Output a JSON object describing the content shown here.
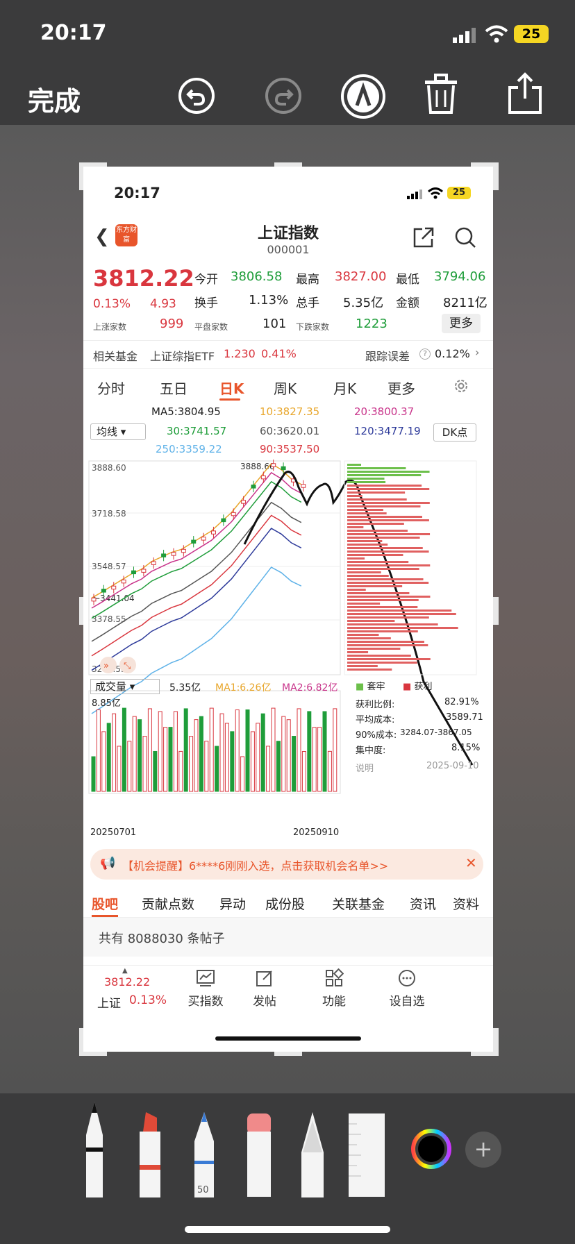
{
  "status_bar": {
    "time": "20:17",
    "battery": "25"
  },
  "markup_toolbar": {
    "done": "完成",
    "tools": [
      "undo-icon",
      "redo-icon",
      "markup-pen-icon",
      "trash-icon",
      "share-icon"
    ]
  },
  "inner_status": {
    "time": "20:17",
    "battery": "25"
  },
  "header": {
    "title": "上证指数",
    "code": "000001",
    "logo": "东方财富"
  },
  "quote": {
    "price": "3812.22",
    "change_pct": "0.13%",
    "change": "4.93",
    "open_label": "今开",
    "open": "3806.58",
    "high_label": "最高",
    "high": "3827.00",
    "low_label": "最低",
    "low": "3794.06",
    "turnover_label": "换手",
    "turnover": "1.13%",
    "volume_label": "总手",
    "volume": "5.35亿",
    "amount_label": "金额",
    "amount": "8211亿",
    "up_label": "上涨家数",
    "up": "999",
    "flat_label": "平盘家数",
    "flat": "101",
    "down_label": "下跌家数",
    "down": "1223",
    "more": "更多"
  },
  "fund": {
    "label": "相关基金",
    "name": "上证综指ETF",
    "price": "1.230",
    "pct": "0.41%",
    "err_label": "跟踪误差",
    "err": "0.12%"
  },
  "period_tabs": [
    "分时",
    "五日",
    "日K",
    "周K",
    "月K",
    "更多"
  ],
  "ma": {
    "selector": "均线",
    "ma5": "MA5:3804.95",
    "ma10": "10:3827.35",
    "ma20": "20:3800.37",
    "ma30": "30:3741.57",
    "ma60": "60:3620.01",
    "ma120": "120:3477.19",
    "ma250": "250:3359.22",
    "ma90": "90:3537.50",
    "dk": "DK点"
  },
  "chart_data": {
    "type": "line",
    "title": "",
    "y_ticks": [
      "3888.60",
      "3718.58",
      "3548.57",
      "3378.55",
      "3208.53"
    ],
    "high_marker": "3888.60",
    "low_marker": "3441.04",
    "ylim": [
      3208.53,
      3888.6
    ],
    "series": [
      {
        "name": "",
        "values": [
          3441,
          3460,
          3480,
          3500,
          3520,
          3535,
          3560,
          3575,
          3590,
          3600,
          3620,
          3640,
          3660,
          3690,
          3720,
          3760,
          3800,
          3840,
          3880,
          3860,
          3830,
          3812
        ]
      }
    ],
    "volume_label": "成交量",
    "volume_value": "5.35亿",
    "vol_ma1": "MA1:6.26亿",
    "vol_ma2": "MA2:6.82亿",
    "vol_top": "8.85亿",
    "x_start": "20250701",
    "x_end": "20250910"
  },
  "chips": {
    "legend_a": "套牢",
    "legend_b": "获利",
    "profit_label": "获利比例:",
    "profit": "82.91%",
    "cost_label": "平均成本:",
    "cost": "3589.71",
    "range_label": "90%成本:",
    "range": "3284.07-3867.05",
    "conc_label": "集中度:",
    "conc": "8.15%",
    "note": "说明",
    "date": "2025-09-10"
  },
  "banner": {
    "text": "【机会提醒】6****6刚刚入选，点击获取机会名单>>"
  },
  "sub_tabs": [
    "股吧",
    "贡献点数",
    "异动",
    "成份股",
    "关联基金",
    "资讯",
    "资料"
  ],
  "posts": "共有 8088030 条帖子",
  "bottom_nav": {
    "price": "3812.22",
    "name": "上证",
    "pct": "0.13%",
    "items": [
      "买指数",
      "发帖",
      "功能",
      "设自选"
    ]
  },
  "pen_tools": {
    "pencil_size": "50"
  }
}
